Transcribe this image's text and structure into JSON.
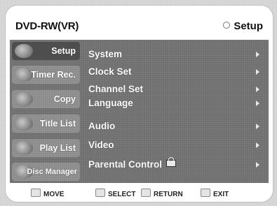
{
  "header": {
    "title": "DVD-RW(VR)",
    "mode": "Setup"
  },
  "sidebar": {
    "items": [
      {
        "label": "Setup",
        "icon": "setup-icon",
        "active": true
      },
      {
        "label": "Timer Rec.",
        "icon": "timer-rec-icon"
      },
      {
        "label": "Copy",
        "icon": "copy-icon"
      },
      {
        "label": "Title List",
        "icon": "title-list-icon"
      },
      {
        "label": "Play List",
        "icon": "play-list-icon"
      },
      {
        "label": "Disc Manager",
        "icon": "disc-manager-icon"
      }
    ]
  },
  "menu": {
    "items": [
      {
        "label": "System"
      },
      {
        "label": "Clock Set"
      },
      {
        "label": "Channel Set"
      },
      {
        "label": "Language"
      },
      {
        "label": "Audio"
      },
      {
        "label": "Video"
      },
      {
        "label": "Parental Control",
        "icon": "lock-icon"
      }
    ]
  },
  "footer": {
    "move": "MOVE",
    "select": "SELECT",
    "return": "RETURN",
    "exit": "EXIT"
  },
  "colors": {
    "panel": "#6e6e6e",
    "active_tab": "#4e4e4e",
    "text": "#ffffff"
  }
}
